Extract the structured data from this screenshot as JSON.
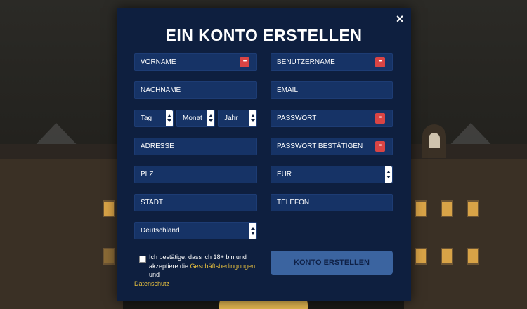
{
  "modal": {
    "title": "EIN KONTO ERSTELLEN",
    "close_label": "×"
  },
  "fields": {
    "vorname": "VORNAME",
    "benutzername": "BENUTZERNAME",
    "nachname": "NACHNAME",
    "email": "EMAIL",
    "tag": "Tag",
    "monat": "Monat",
    "jahr": "Jahr",
    "passwort": "PASSWORT",
    "adresse": "ADRESSE",
    "passwort_bestaetigen": "PASSWORT BESTÄTIGEN",
    "plz": "PLZ",
    "currency": "EUR",
    "stadt": "STADT",
    "telefon": "TELEFON",
    "country": "Deutschland"
  },
  "consent": {
    "line1": "Ich bestätige, dass ich 18+ bin und",
    "line2_prefix": "akzeptiere die ",
    "terms_link": "Geschäftsbedingungen",
    "line2_suffix": " und",
    "privacy_link": "Datenschutz"
  },
  "submit_label": "KONTO ERSTELLEN",
  "icons": {
    "close": "close-icon",
    "dots": "more-dots-icon",
    "spinner": "select-spinner-icon",
    "checkbox": "checkbox-icon"
  },
  "colors": {
    "modal_bg": "#0e1f3f",
    "field_bg": "#163366",
    "dots_badge": "#d94444",
    "link": "#e7c03f",
    "submit_bg": "#3b64a0"
  }
}
